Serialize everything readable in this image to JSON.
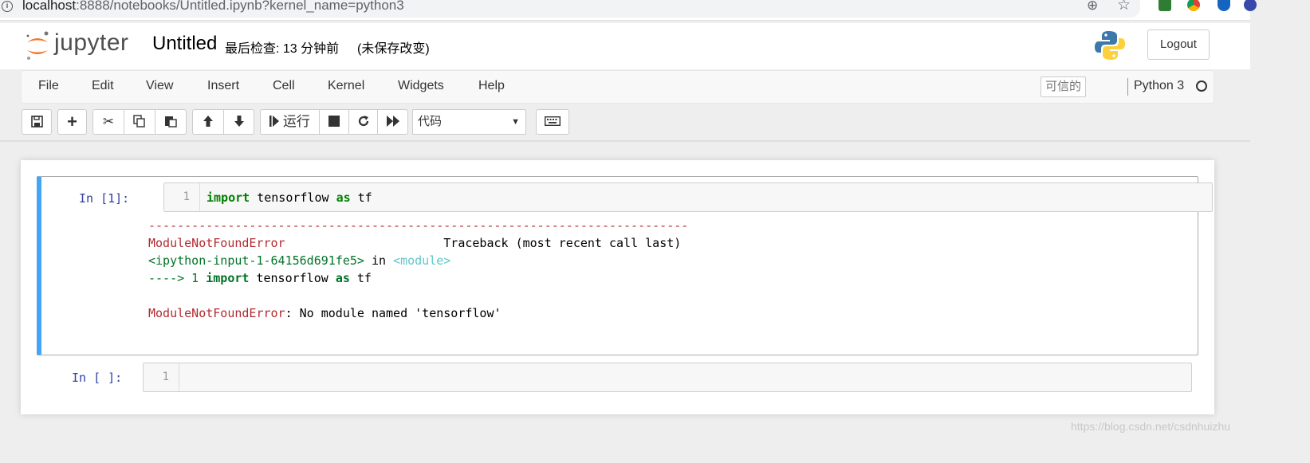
{
  "browser": {
    "url_host": "localhost",
    "url_rest": ":8888/notebooks/Untitled.ipynb?kernel_name=python3"
  },
  "header": {
    "logo_text": "jupyter",
    "notebook_title": "Untitled",
    "checkpoint": "最后检查: 13 分钟前",
    "autosave": "(未保存改变)",
    "logout_label": "Logout"
  },
  "menu": {
    "items": [
      "File",
      "Edit",
      "View",
      "Insert",
      "Cell",
      "Kernel",
      "Widgets",
      "Help"
    ],
    "trusted": "可信的",
    "kernel_name": "Python 3"
  },
  "toolbar": {
    "run_label": "运行",
    "cell_type": "代码"
  },
  "cells": [
    {
      "prompt": "In  [1]:",
      "line_number": "1",
      "code": {
        "kw1": "import",
        "mid": " tensorflow ",
        "kw2": "as",
        "end": " tf"
      },
      "output": {
        "dashes": "---------------------------------------------------------------------------",
        "err_name": "ModuleNotFoundError",
        "traceback_label": "Traceback (most recent call last)",
        "input_ref": "<ipython-input-1-64156d691fe5>",
        "in_word": " in ",
        "module_ref": "<module>",
        "arrow": "----> 1 ",
        "arrow_kw1": "import",
        "arrow_mid": " tensorflow ",
        "arrow_kw2": "as",
        "arrow_end": " tf",
        "final_msg": ": No module named 'tensorflow'"
      }
    },
    {
      "prompt": "In  [ ]:",
      "line_number": "1"
    }
  ],
  "watermark": "https://blog.csdn.net/csdnhuizhu",
  "colors": {
    "selected_cell_border": "#42a5f5",
    "error": "#b22b31",
    "prompt": "#303f9f",
    "logo_orange": "#f37626"
  }
}
